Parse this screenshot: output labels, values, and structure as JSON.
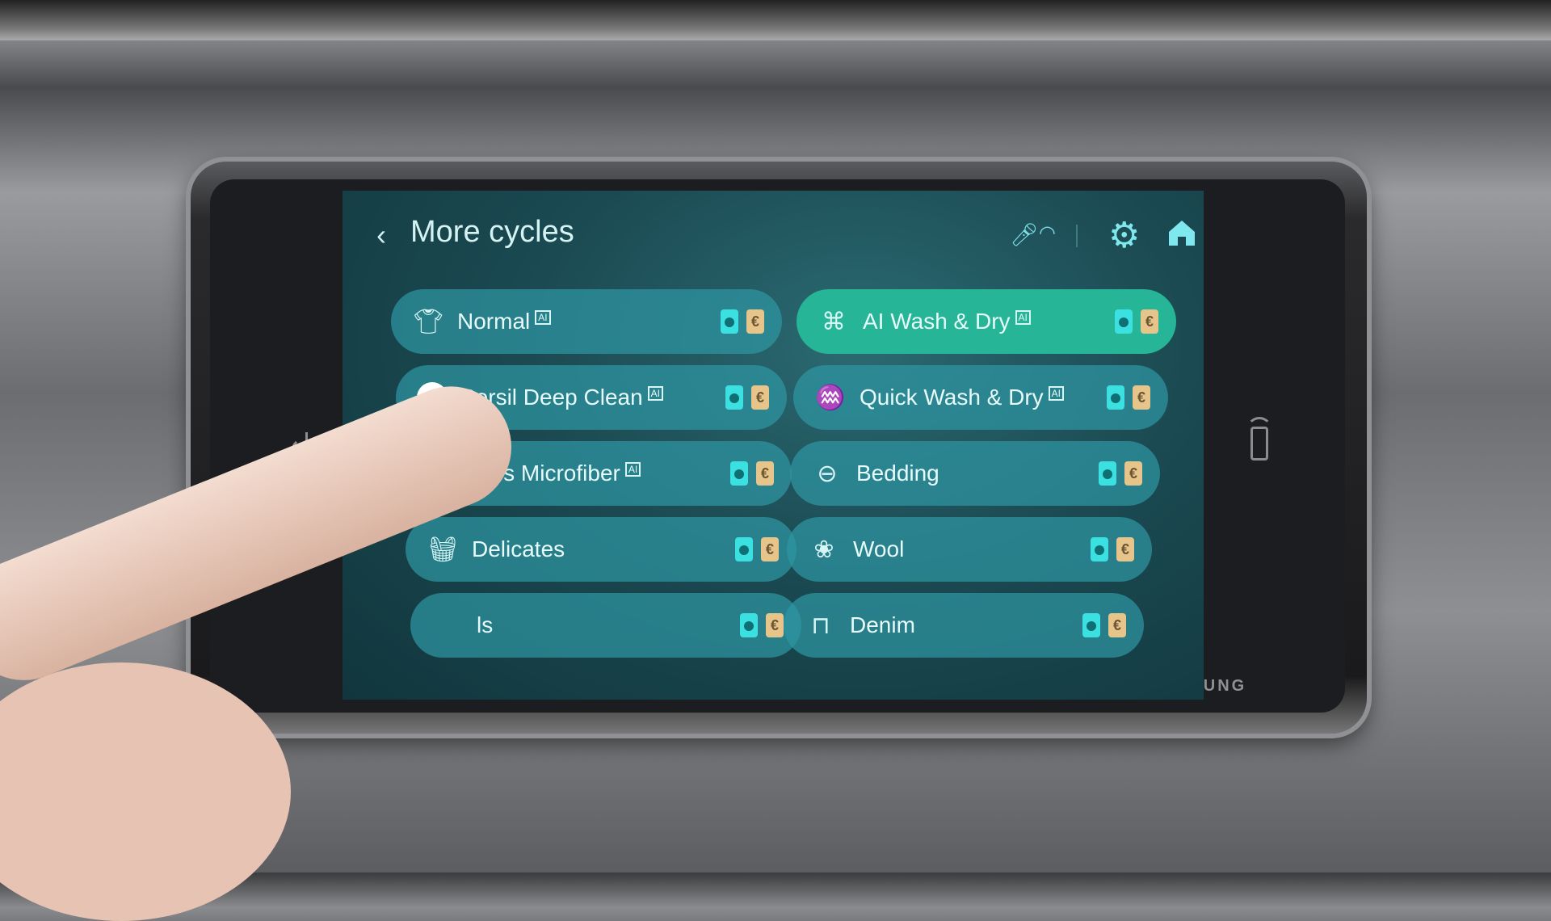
{
  "header": {
    "back_icon": "chevron-left-icon",
    "title": "More cycles",
    "icons": [
      "microphone-icon",
      "wifi-icon",
      "gear-icon",
      "home-icon"
    ]
  },
  "ai_badge": "AI",
  "cycles": {
    "left": [
      {
        "label": "Normal",
        "icon": "shirt-icon",
        "ai": true
      },
      {
        "label": "Persil Deep Clean",
        "icon": "persil-logo",
        "ai": true
      },
      {
        "label": "Less Microfiber",
        "icon": "shirt-filter-icon",
        "ai": true
      },
      {
        "label": "Delicates",
        "icon": "basin-icon",
        "ai": false
      },
      {
        "label": "ls",
        "icon": "",
        "ai": false
      }
    ],
    "right": [
      {
        "label": "AI Wash & Dry",
        "icon": "ai-brain-icon",
        "ai": true,
        "selected": true
      },
      {
        "label": "Quick Wash & Dry",
        "icon": "quick-wash-icon",
        "ai": true
      },
      {
        "label": "Bedding",
        "icon": "bedding-icon",
        "ai": false
      },
      {
        "label": "Wool",
        "icon": "sheep-icon",
        "ai": false
      },
      {
        "label": "Denim",
        "icon": "jeans-icon",
        "ai": false
      }
    ]
  },
  "persil_logo_text": "Persil",
  "energy_badge": "€",
  "brand": "SAMSUNG",
  "colors": {
    "selected": "#27b597",
    "row": "#2e96a2",
    "washer_badge": "#3be0e0",
    "energy_badge": "#e7c48a"
  }
}
